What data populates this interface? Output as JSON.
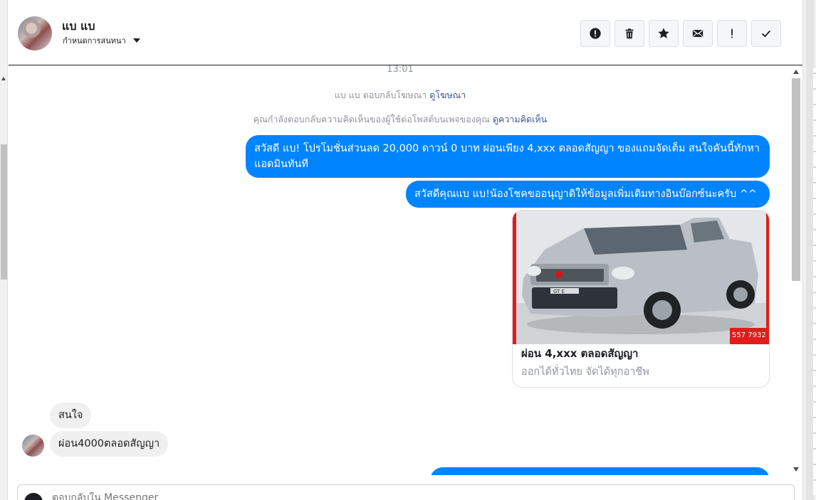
{
  "header": {
    "contact_name": "แบ แบ",
    "conversation_menu_label": "กำหนดการสนทนา",
    "toolbar": [
      {
        "icon": "exclamation-circle-icon"
      },
      {
        "icon": "trash-icon"
      },
      {
        "icon": "star-icon"
      },
      {
        "icon": "envelope-icon"
      },
      {
        "icon": "exclamation-icon"
      },
      {
        "icon": "checkmark-icon"
      }
    ]
  },
  "thread": {
    "timestamp": "13:01",
    "ad_reply_notice": "แบ แบ ตอบกลับโฆษณา",
    "ad_reply_link": "ดูโฆษณา",
    "comment_notice": "คุณกำลังตอบกลับความคิดเห็นของผู้ใช้ต่อโพสต์บนเพจของคุณ",
    "comment_link": "ดูความคิดเห็น",
    "outgoing_1": "สวัสดี แบ! โปรโมชั่นส่วนลด 20,000 ดาวน์ 0 บาท ผ่อนเพียง 4,xxx ตลอดสัญญา ของแถมจัดเต็ม สนใจคันนี้ทักหาแอดมินทันที",
    "outgoing_2": "สวัสดีคุณแบ แบ!น้องโชคขออนุญาติให้ข้อมูลเพิ่มเติมทางอินบ๊อกซ์นะครับ ^^",
    "card": {
      "title": "ผ่อน 4,xxx ตลอดสัญญา",
      "subtitle": "ออกได้ทั่วไทย จัดได้ทุกอาชีพ",
      "image_text": "GT E",
      "phone_text": "557 7932"
    },
    "incoming_1": "สนใจ",
    "incoming_2": "ผ่อน4000ตลอดสัญญา"
  },
  "composer": {
    "placeholder": "ตอบกลับใน Messenger"
  },
  "colors": {
    "outgoing_bubble": "#0084ff",
    "incoming_bubble": "#f1f0f0",
    "link": "#385898",
    "card_frame": "#e31b1b"
  }
}
